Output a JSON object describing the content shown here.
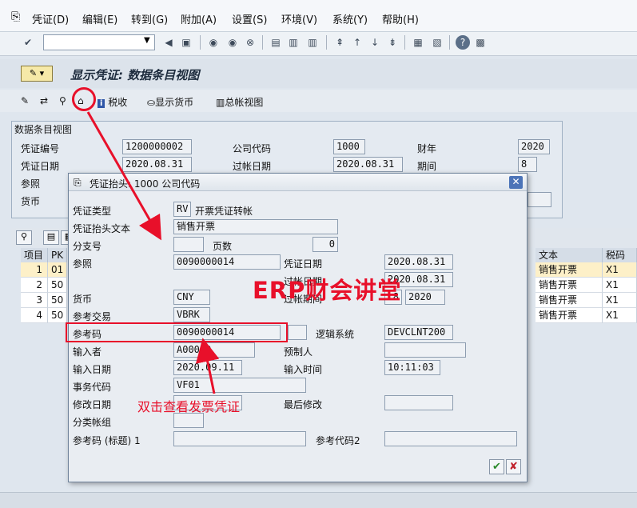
{
  "menu": [
    "凭证(D)",
    "编辑(E)",
    "转到(G)",
    "附加(A)",
    "设置(S)",
    "环境(V)",
    "系统(Y)",
    "帮助(H)"
  ],
  "app_title": "显示凭证: 数据条目视图",
  "app_toolbar": {
    "tax": "税收",
    "display_currency": "显示货币",
    "ledger_view": "总帐视图"
  },
  "group": {
    "title": "数据条目视图",
    "doc_no_label": "凭证编号",
    "doc_no": "1200000002",
    "company_label": "公司代码",
    "company": "1000",
    "fiscal_year_label": "财年",
    "fiscal_year": "2020",
    "doc_date_label": "凭证日期",
    "doc_date": "2020.08.31",
    "posting_date_label": "过帐日期",
    "posting_date": "2020.08.31",
    "period_label": "期间",
    "period": "8",
    "reference_label": "参照",
    "currency_label": "货币"
  },
  "table": {
    "headers": [
      "项目",
      "PK"
    ],
    "right_headers": [
      "文本",
      "税码"
    ],
    "rows": [
      {
        "item": "1",
        "pk": "01",
        "text": "销售开票",
        "tax": "X1"
      },
      {
        "item": "2",
        "pk": "50",
        "text": "销售开票",
        "tax": "X1"
      },
      {
        "item": "3",
        "pk": "50",
        "text": "销售开票",
        "tax": "X1"
      },
      {
        "item": "4",
        "pk": "50",
        "text": "销售开票",
        "tax": "X1"
      }
    ]
  },
  "dialog": {
    "title": "凭证抬头: 1000 公司代码",
    "doc_type_label": "凭证类型",
    "doc_type": "RV",
    "doc_type_desc": "开票凭证转帐",
    "header_text_label": "凭证抬头文本",
    "header_text": "销售开票",
    "branch_label": "分支号",
    "pages_label": "页数",
    "pages": "0",
    "ref_label": "参照",
    "ref": "0090000014",
    "doc_date_label": "凭证日期",
    "doc_date": "2020.08.31",
    "posting_date_label": "过帐日期",
    "posting_date": "2020.08.31",
    "posting_period_label": "过帐期间",
    "posting_period": "8",
    "posting_year": "2020",
    "currency_label": "货币",
    "currency": "CNY",
    "ref_trans_label": "参考交易",
    "ref_trans": "VBRK",
    "ref_key_label": "参考码",
    "ref_key": "0090000014",
    "log_system_label": "逻辑系统",
    "log_system": "DEVCLNT200",
    "entered_by_label": "输入者",
    "entered_by": "A00000",
    "parked_by_label": "预制人",
    "entry_date_label": "输入日期",
    "entry_date": "2020.09.11",
    "entry_time_label": "输入时间",
    "entry_time": "10:11:03",
    "tcode_label": "事务代码",
    "tcode": "VF01",
    "changed_on_label": "修改日期",
    "last_change_label": "最后修改",
    "ledger_group_label": "分类帐组",
    "ref_key_head_label": "参考码 (标题) 1",
    "ref_key2_label": "参考代码2"
  },
  "annotations": {
    "watermark": "ERP财会讲堂",
    "hint": "双击查看发票凭证",
    "color": "#e8102a"
  }
}
